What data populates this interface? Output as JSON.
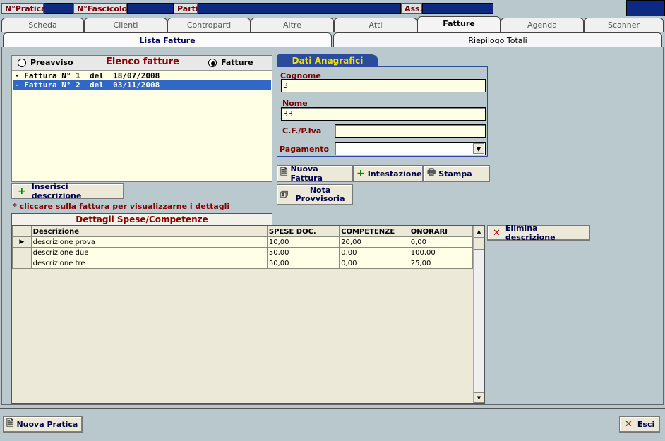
{
  "header": {
    "pratica_label": "N°Pratica",
    "fascicolo_label": "N°Fascicolo",
    "parti_label": "Parti",
    "ass_label": "Ass."
  },
  "tabs": [
    "Scheda",
    "Clienti",
    "Controparti",
    "Altre",
    "Atti",
    "Fatture",
    "Agenda",
    "Scanner"
  ],
  "subtabs": [
    "Lista Fatture",
    "Riepilogo Totali"
  ],
  "invoice_list": {
    "preavviso_label": "Preavviso",
    "title": "Elenco fatture",
    "fatture_label": "Fatture",
    "items": [
      "- Fattura N° 1  del  18/07/2008",
      "- Fattura N° 2  del  03/11/2008"
    ]
  },
  "anagrafica": {
    "title": "Dati Anagrafici",
    "cognome_label": "Cognome",
    "cognome_value": "3",
    "nome_label": "Nome",
    "nome_value": "33",
    "cf_label": "C.F./P.Iva",
    "cf_value": "",
    "pagamento_label": "Pagamento",
    "pagamento_value": ""
  },
  "buttons": {
    "nuova_fattura": "Nuova Fattura",
    "intestazione": "Intestazione",
    "stampa": "Stampa",
    "nota_provvisoria_1": "Nota",
    "nota_provvisoria_2": "Provvisoria",
    "inserisci_descrizione": "Inserisci descrizione",
    "elimina_descrizione": "Elimina descrizione",
    "nuova_pratica": "Nuova Pratica",
    "esci": "Esci"
  },
  "hint": "* cliccare sulla fattura per visualizzarne i dettagli",
  "details": {
    "title": "Dettagli Spese/Competenze",
    "columns": [
      "Descrizione",
      "SPESE DOC.",
      "COMPETENZE",
      "ONORARI"
    ],
    "rows": [
      [
        "descrizione prova",
        "10,00",
        "20,00",
        "0,00"
      ],
      [
        "descrizione due",
        "50,00",
        "0,00",
        "100,00"
      ],
      [
        "descrizione tre",
        "50,00",
        "0,00",
        "25,00"
      ]
    ]
  }
}
